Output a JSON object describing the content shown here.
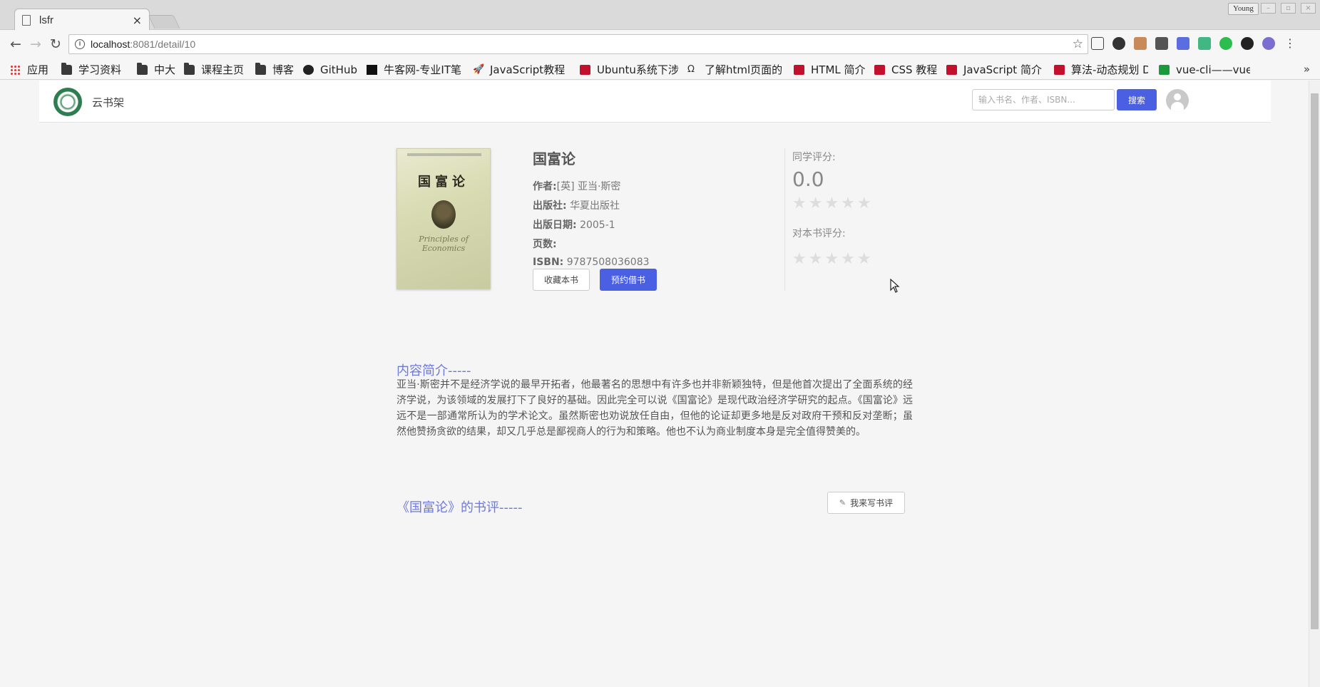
{
  "browser": {
    "tab_title": "lsfr",
    "tab_close": "×",
    "profile_name": "Young",
    "url_host": "localhost",
    "url_path": ":8081/detail/10",
    "star_icon": "☆"
  },
  "bookmarks": {
    "apps": "应用",
    "items": [
      {
        "label": "学习资料",
        "icon": "folder-icon"
      },
      {
        "label": "中大",
        "icon": "folder-icon"
      },
      {
        "label": "课程主页",
        "icon": "folder-icon"
      },
      {
        "label": "博客",
        "icon": "folder-icon"
      },
      {
        "label": "GitHub",
        "icon": "github-icon"
      },
      {
        "label": "牛客网-专业IT笔",
        "icon": "nowcoder-icon"
      },
      {
        "label": "JavaScript教程",
        "icon": "rocket-icon"
      },
      {
        "label": "Ubuntu系统下涉",
        "icon": "c-icon"
      },
      {
        "label": "了解html页面的",
        "icon": "omega-icon"
      },
      {
        "label": "HTML 简介",
        "icon": "runoob-icon"
      },
      {
        "label": "CSS 教程",
        "icon": "runoob-icon"
      },
      {
        "label": "JavaScript 简介",
        "icon": "runoob-icon"
      },
      {
        "label": "算法-动态规划 D",
        "icon": "c-icon"
      },
      {
        "label": "vue-cli——vue-r",
        "icon": "sf-icon"
      }
    ],
    "more": "»"
  },
  "site": {
    "name": "云书架",
    "search_placeholder": "输入书名、作者、ISBN...",
    "search_button": "搜索"
  },
  "book": {
    "cover_title": "国富论",
    "cover_subtitle": "Principles of Economics",
    "title": "国富论",
    "author_label": "作者:",
    "author": "[英] 亚当·斯密",
    "publisher_label": "出版社:",
    "publisher": "华夏出版社",
    "pubdate_label": "出版日期:",
    "pubdate": "2005-1",
    "pages_label": "页数:",
    "pages": "",
    "isbn_label": "ISBN:",
    "isbn": "9787508036083",
    "fav_button": "收藏本书",
    "borrow_button": "预约借书"
  },
  "rating": {
    "peer_label": "同学评分:",
    "peer_score": "0.0",
    "peer_stars": 0,
    "my_label": "对本书评分:",
    "my_stars": 0,
    "star_glyphs": "★★★★★"
  },
  "summary": {
    "heading": "内容简介-----",
    "text": "亚当·斯密并不是经济学说的最早开拓者，他最著名的思想中有许多也并非新颖独特，但是他首次提出了全面系统的经济学说，为该领域的发展打下了良好的基础。因此完全可以说《国富论》是现代政治经济学研究的起点。《国富论》远远不是一部通常所认为的学术论文。虽然斯密也劝说放任自由，但他的论证却更多地是反对政府干预和反对垄断；虽然他赞扬贪欲的结果，却又几乎总是鄙视商人的行为和策略。他也不认为商业制度本身是完全值得赞美的。"
  },
  "reviews": {
    "heading": "《国富论》的书评-----",
    "write_button": "我来写书评"
  },
  "colors": {
    "accent": "#4a5fe1",
    "heading": "#6f7ad8"
  }
}
